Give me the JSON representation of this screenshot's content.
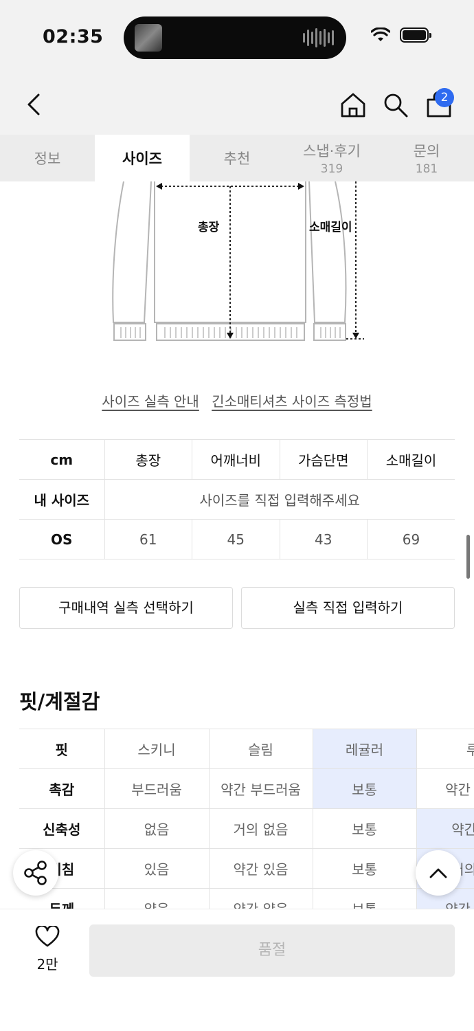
{
  "status": {
    "time": "02:35"
  },
  "nav": {
    "cart_count": "2"
  },
  "tabs": [
    {
      "label": "정보",
      "count": ""
    },
    {
      "label": "사이즈",
      "count": ""
    },
    {
      "label": "추천",
      "count": ""
    },
    {
      "label": "스냅·후기",
      "count": "319"
    },
    {
      "label": "문의",
      "count": "181"
    }
  ],
  "diagram": {
    "length_label": "총장",
    "sleeve_label": "소매길이"
  },
  "links": {
    "measure_guide": "사이즈 실측 안내",
    "method": "긴소매티셔츠 사이즈 측정법"
  },
  "size_table": {
    "headers": [
      "cm",
      "총장",
      "어깨너비",
      "가슴단면",
      "소매길이"
    ],
    "my_size_label": "내 사이즈",
    "my_size_prompt": "사이즈를 직접 입력해주세요",
    "rows": [
      {
        "size": "OS",
        "values": [
          "61",
          "45",
          "43",
          "69"
        ]
      }
    ]
  },
  "buttons": {
    "purchase_history": "구매내역 실측 선택하기",
    "direct_input": "실측 직접 입력하기"
  },
  "fit_section": {
    "title": "핏/계절감",
    "rows": [
      {
        "label": "핏",
        "options": [
          "스키니",
          "슬림",
          "레귤러",
          "루즈"
        ]
      },
      {
        "label": "촉감",
        "options": [
          "부드러움",
          "약간 부드러움",
          "보통",
          "약간 뻣뻣함"
        ]
      },
      {
        "label": "신축성",
        "options": [
          "없음",
          "거의 없음",
          "보통",
          "약간 있음"
        ]
      },
      {
        "label": "비침",
        "options": [
          "있음",
          "약간 있음",
          "보통",
          "거의 없음"
        ]
      },
      {
        "label": "두께",
        "options": [
          "얇음",
          "약간 얇음",
          "보통",
          "약간 두꺼움"
        ]
      }
    ],
    "selected_column": [
      2,
      2,
      3,
      3,
      3
    ]
  },
  "bottom": {
    "like_count": "2만",
    "soldout_label": "품절"
  },
  "colors": {
    "accent": "#2f6bf0",
    "selected_cell": "#e7edfd"
  }
}
